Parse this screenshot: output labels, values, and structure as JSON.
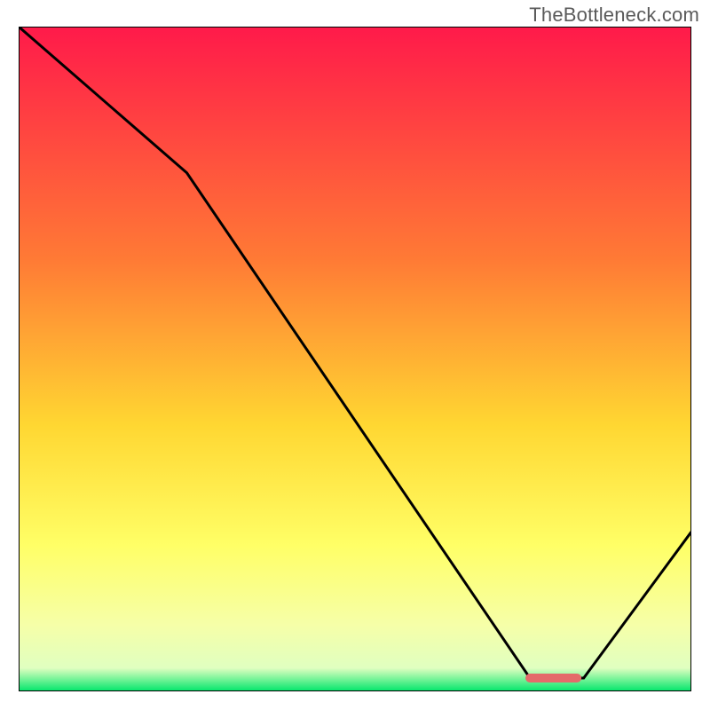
{
  "attribution": "TheBottleneck.com",
  "chart_data": {
    "type": "line",
    "title": "",
    "xlabel": "",
    "ylabel": "",
    "xlim": [
      0,
      100
    ],
    "ylim": [
      0,
      100
    ],
    "gradient_stops": [
      {
        "offset": 0.0,
        "color": "#ff1a4a"
      },
      {
        "offset": 0.35,
        "color": "#ff7a35"
      },
      {
        "offset": 0.6,
        "color": "#ffd732"
      },
      {
        "offset": 0.78,
        "color": "#ffff66"
      },
      {
        "offset": 0.9,
        "color": "#f6ffa8"
      },
      {
        "offset": 0.965,
        "color": "#e0ffc0"
      },
      {
        "offset": 1.0,
        "color": "#00e66b"
      }
    ],
    "curve": [
      {
        "x": 0,
        "y": 100
      },
      {
        "x": 25,
        "y": 78
      },
      {
        "x": 76,
        "y": 2
      },
      {
        "x": 84,
        "y": 2
      },
      {
        "x": 100,
        "y": 24
      }
    ],
    "marker": {
      "x_start": 76,
      "x_end": 83,
      "y": 2,
      "color": "#e46a6a"
    }
  }
}
